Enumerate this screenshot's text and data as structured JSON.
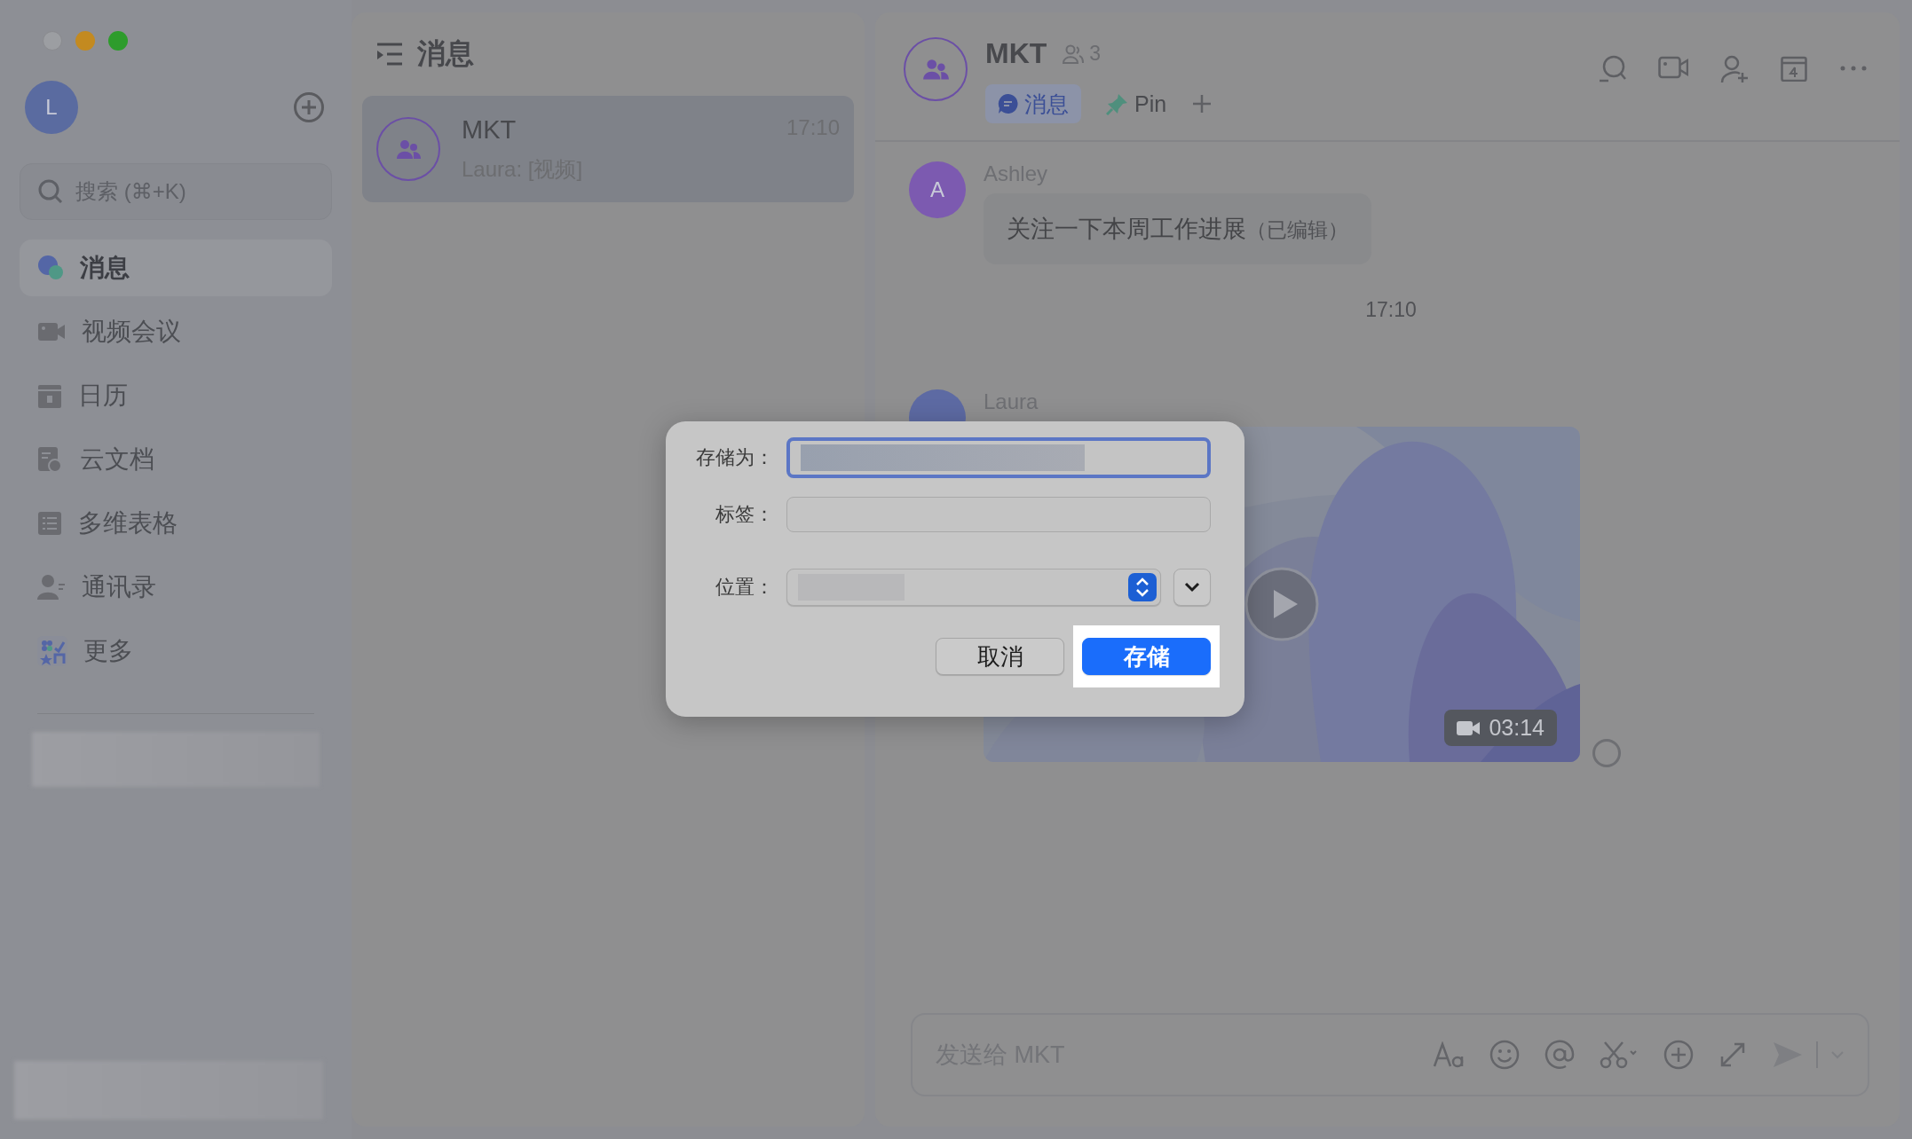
{
  "window": {
    "controls": [
      {
        "kind": "close"
      },
      {
        "kind": "minimize"
      },
      {
        "kind": "zoom"
      }
    ]
  },
  "sidebar": {
    "avatar": "L",
    "search": {
      "placeholder": "搜索 (⌘+K)"
    },
    "items": [
      {
        "label": "消息",
        "selected": true
      },
      {
        "label": "视频会议",
        "selected": false
      },
      {
        "label": "日历",
        "selected": false
      },
      {
        "label": "云文档",
        "selected": false
      },
      {
        "label": "多维表格",
        "selected": false
      },
      {
        "label": "通讯录",
        "selected": false
      },
      {
        "label": "更多",
        "selected": false
      }
    ]
  },
  "chat_list": {
    "title": "消息",
    "chats": [
      {
        "name": "MKT",
        "preview": "Laura: [视频]",
        "time": "17:10",
        "selected": true
      }
    ]
  },
  "chat": {
    "title": "MKT",
    "member_count": "3",
    "tabs": [
      {
        "label": "消息",
        "selected": true
      },
      {
        "label": "Pin",
        "selected": false
      }
    ],
    "messages": [
      {
        "kind": "text",
        "sender": "Ashley",
        "avatar": "A",
        "text": "关注一下本周工作进展",
        "note": "（已编辑）"
      },
      {
        "kind": "time",
        "text": "17:10"
      },
      {
        "kind": "video",
        "sender": "Laura",
        "duration": "03:14",
        "selected": false
      }
    ],
    "composer": {
      "placeholder": "发送给 MKT"
    }
  },
  "dialog": {
    "fields": [
      {
        "label": "存储为：",
        "kind": "text",
        "focused": true
      },
      {
        "label": "标签：",
        "kind": "text",
        "focused": false
      },
      {
        "label": "位置：",
        "kind": "popup",
        "focused": false
      }
    ],
    "buttons": [
      {
        "label": "取消",
        "kind": "cancel",
        "highlighted": false
      },
      {
        "label": "存储",
        "kind": "default",
        "highlighted": true
      }
    ]
  }
}
